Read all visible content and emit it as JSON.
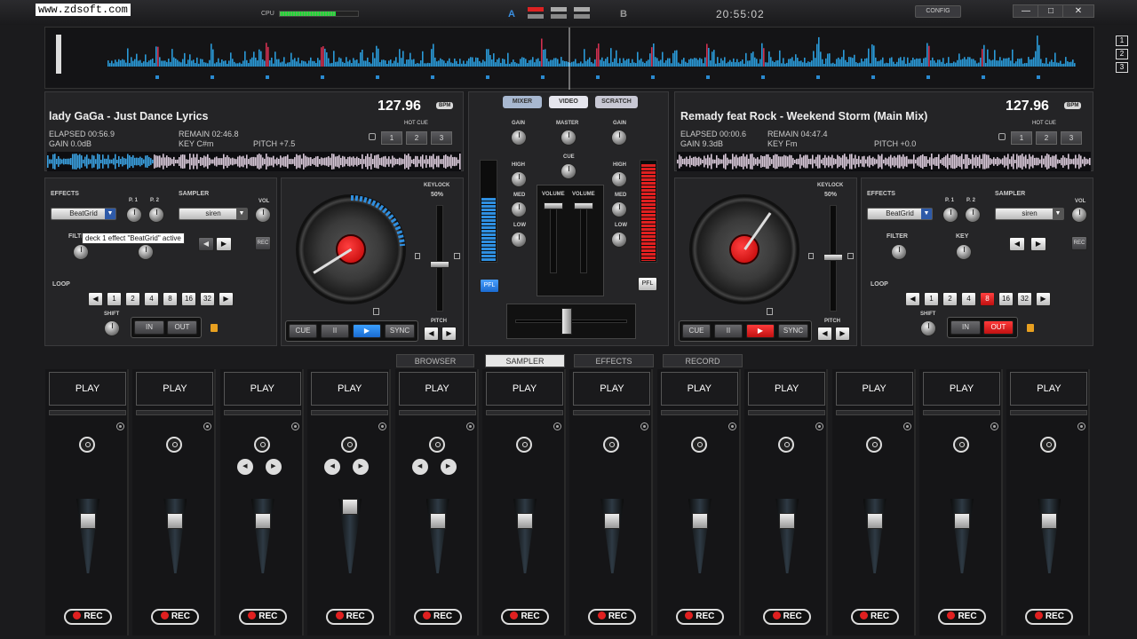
{
  "watermark": "www.zdsoft.com",
  "topbar": {
    "cpu_label": "CPU",
    "deck_a": "A",
    "deck_b": "B",
    "clock": "20:55:02",
    "config_label": "CONFIG",
    "min": "—",
    "max": "□",
    "close": "✕"
  },
  "overview": {
    "pages": [
      "1",
      "2",
      "3"
    ]
  },
  "deck_left": {
    "title": "lady GaGa - Just Dance Lyrics",
    "bpm": "127.96",
    "bpm_label": "BPM",
    "elapsed": "ELAPSED 00:56.9",
    "remain": "REMAIN 02:46.8",
    "gain": "GAIN 0.0dB",
    "key": "KEY C#m",
    "pitch": "PITCH +7.5",
    "hotcue_label": "HOT CUE",
    "hotcues": [
      "1",
      "2",
      "3"
    ],
    "effects_label": "EFFECTS",
    "effect": "BeatGrid",
    "p1": "P. 1",
    "p2": "P. 2",
    "sampler_label": "SAMPLER",
    "sampler": "siren",
    "vol": "VOL",
    "rec": "REC",
    "filter_label": "FILTER",
    "key_label": "KEY",
    "loop_label": "LOOP",
    "loops": [
      "1",
      "2",
      "4",
      "8",
      "16",
      "32"
    ],
    "shift": "SHIFT",
    "in": "IN",
    "out": "OUT",
    "keylock": "KEYLOCK",
    "keylock_pct": "50%",
    "cue": "CUE",
    "pause": "II",
    "play": "▶",
    "sync": "SYNC",
    "pitch_label": "PITCH",
    "tooltip": "deck 1 effect \"BeatGrid\" active"
  },
  "deck_right": {
    "title": "Remady feat Rock - Weekend Storm (Main Mix)",
    "bpm": "127.96",
    "bpm_label": "BPM",
    "elapsed": "ELAPSED 00:00.6",
    "remain": "REMAIN 04:47.4",
    "gain": "GAIN 9.3dB",
    "key": "KEY Fm",
    "pitch": "PITCH +0.0",
    "hotcue_label": "HOT CUE",
    "hotcues": [
      "1",
      "2",
      "3"
    ],
    "effects_label": "EFFECTS",
    "effect": "BeatGrid",
    "p1": "P. 1",
    "p2": "P. 2",
    "sampler_label": "SAMPLER",
    "sampler": "siren",
    "vol": "VOL",
    "rec": "REC",
    "filter_label": "FILTER",
    "key_label": "KEY",
    "loop_label": "LOOP",
    "loops": [
      "1",
      "2",
      "4",
      "8",
      "16",
      "32"
    ],
    "active_loop": "8",
    "shift": "SHIFT",
    "in": "IN",
    "out": "OUT",
    "keylock": "KEYLOCK",
    "keylock_pct": "50%",
    "cue": "CUE",
    "pause": "II",
    "play": "▶",
    "sync": "SYNC",
    "pitch_label": "PITCH"
  },
  "mixer": {
    "tabs": [
      "MIXER",
      "VIDEO",
      "SCRATCH"
    ],
    "gain": "GAIN",
    "master": "MASTER",
    "cue": "CUE",
    "high": "HIGH",
    "med": "MED",
    "low": "LOW",
    "volume": "VOLUME",
    "pfl": "PFL"
  },
  "bottom_tabs": [
    "BROWSER",
    "SAMPLER",
    "EFFECTS",
    "RECORD"
  ],
  "sampler": {
    "play": "PLAY",
    "rec": "REC",
    "lanes": 12
  },
  "colors": {
    "accent_blue": "#2f8fe0",
    "accent_red": "#e02020"
  }
}
